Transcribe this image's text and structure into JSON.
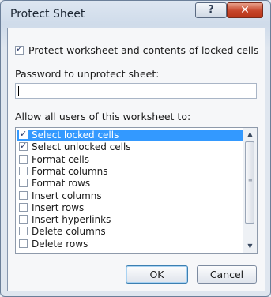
{
  "window": {
    "title": "Protect Sheet",
    "help_label": "?",
    "close_label": "✕"
  },
  "protect_checkbox": {
    "label": "Protect worksheet and contents of locked cells",
    "checked": true
  },
  "password": {
    "label": "Password to unprotect sheet:",
    "value": ""
  },
  "permissions": {
    "label": "Allow all users of this worksheet to:",
    "items": [
      {
        "label": "Select locked cells",
        "checked": true,
        "selected": true
      },
      {
        "label": "Select unlocked cells",
        "checked": true,
        "selected": false
      },
      {
        "label": "Format cells",
        "checked": false,
        "selected": false
      },
      {
        "label": "Format columns",
        "checked": false,
        "selected": false
      },
      {
        "label": "Format rows",
        "checked": false,
        "selected": false
      },
      {
        "label": "Insert columns",
        "checked": false,
        "selected": false
      },
      {
        "label": "Insert rows",
        "checked": false,
        "selected": false
      },
      {
        "label": "Insert hyperlinks",
        "checked": false,
        "selected": false
      },
      {
        "label": "Delete columns",
        "checked": false,
        "selected": false
      },
      {
        "label": "Delete rows",
        "checked": false,
        "selected": false
      }
    ]
  },
  "buttons": {
    "ok": "OK",
    "cancel": "Cancel"
  },
  "scrollbar": {
    "up_icon": "▲",
    "down_icon": "▼",
    "grip_icon": "≡"
  }
}
